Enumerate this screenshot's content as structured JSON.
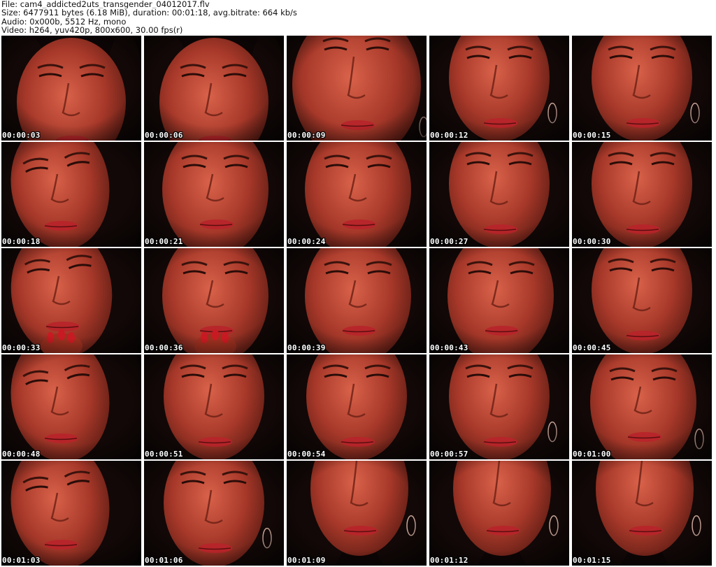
{
  "header": {
    "file_line": "File: cam4_addicted2uts_transgender_04012017.flv",
    "size_line": "Size: 6477911 bytes (6.18 MiB), duration: 00:01:18, avg.bitrate: 664 kb/s",
    "audio_line": "Audio: 0x000b, 5512 Hz, mono",
    "video_line": "Video: h264, yuv420p, 800x600, 30.00 fps(r)"
  },
  "thumbnails": [
    {
      "timestamp": "00:00:03",
      "pose": "face-right",
      "hoop": false,
      "hand": false
    },
    {
      "timestamp": "00:00:06",
      "pose": "face-right",
      "hoop": false,
      "hand": false
    },
    {
      "timestamp": "00:00:09",
      "pose": "close-up",
      "hoop": true,
      "hand": false
    },
    {
      "timestamp": "00:00:12",
      "pose": "looking-down",
      "hoop": true,
      "hand": false
    },
    {
      "timestamp": "00:00:15",
      "pose": "looking-down",
      "hoop": true,
      "hand": false
    },
    {
      "timestamp": "00:00:18",
      "pose": "looking-down-left",
      "hoop": false,
      "hand": false
    },
    {
      "timestamp": "00:00:21",
      "pose": "face-center",
      "hoop": false,
      "hand": false
    },
    {
      "timestamp": "00:00:24",
      "pose": "face-center",
      "hoop": false,
      "hand": false
    },
    {
      "timestamp": "00:00:27",
      "pose": "looking-down",
      "hoop": false,
      "hand": false
    },
    {
      "timestamp": "00:00:30",
      "pose": "looking-down",
      "hoop": false,
      "hand": false
    },
    {
      "timestamp": "00:00:33",
      "pose": "face-left",
      "hoop": false,
      "hand": true
    },
    {
      "timestamp": "00:00:36",
      "pose": "face-center",
      "hoop": false,
      "hand": true
    },
    {
      "timestamp": "00:00:39",
      "pose": "face-center",
      "hoop": false,
      "hand": false
    },
    {
      "timestamp": "00:00:43",
      "pose": "face-center",
      "hoop": false,
      "hand": false
    },
    {
      "timestamp": "00:00:45",
      "pose": "looking-down",
      "hoop": false,
      "hand": false
    },
    {
      "timestamp": "00:00:48",
      "pose": "looking-down-left",
      "hoop": false,
      "hand": false
    },
    {
      "timestamp": "00:00:51",
      "pose": "looking-down",
      "hoop": false,
      "hand": false
    },
    {
      "timestamp": "00:00:54",
      "pose": "looking-down",
      "hoop": false,
      "hand": false
    },
    {
      "timestamp": "00:00:57",
      "pose": "looking-down",
      "hoop": true,
      "hand": false
    },
    {
      "timestamp": "00:01:00",
      "pose": "face-center",
      "hoop": true,
      "hand": false
    },
    {
      "timestamp": "00:01:03",
      "pose": "looking-down-left",
      "hoop": false,
      "hand": false
    },
    {
      "timestamp": "00:01:06",
      "pose": "looking-down",
      "hoop": true,
      "hand": false
    },
    {
      "timestamp": "00:01:09",
      "pose": "chin-low",
      "hoop": true,
      "hand": false
    },
    {
      "timestamp": "00:01:12",
      "pose": "chin-low",
      "hoop": true,
      "hand": false
    },
    {
      "timestamp": "00:01:15",
      "pose": "chin-low",
      "hoop": true,
      "hand": false
    }
  ],
  "colors": {
    "background": "#ffffff",
    "header_text": "#111111",
    "frame_dark": "#0d0505",
    "skin_light": "#d9624a",
    "skin_mid": "#a8392a",
    "skin_shadow": "#5a1a12",
    "hair": "#120807",
    "lips": "#b8232a",
    "timestamp_text": "#ffffff"
  }
}
